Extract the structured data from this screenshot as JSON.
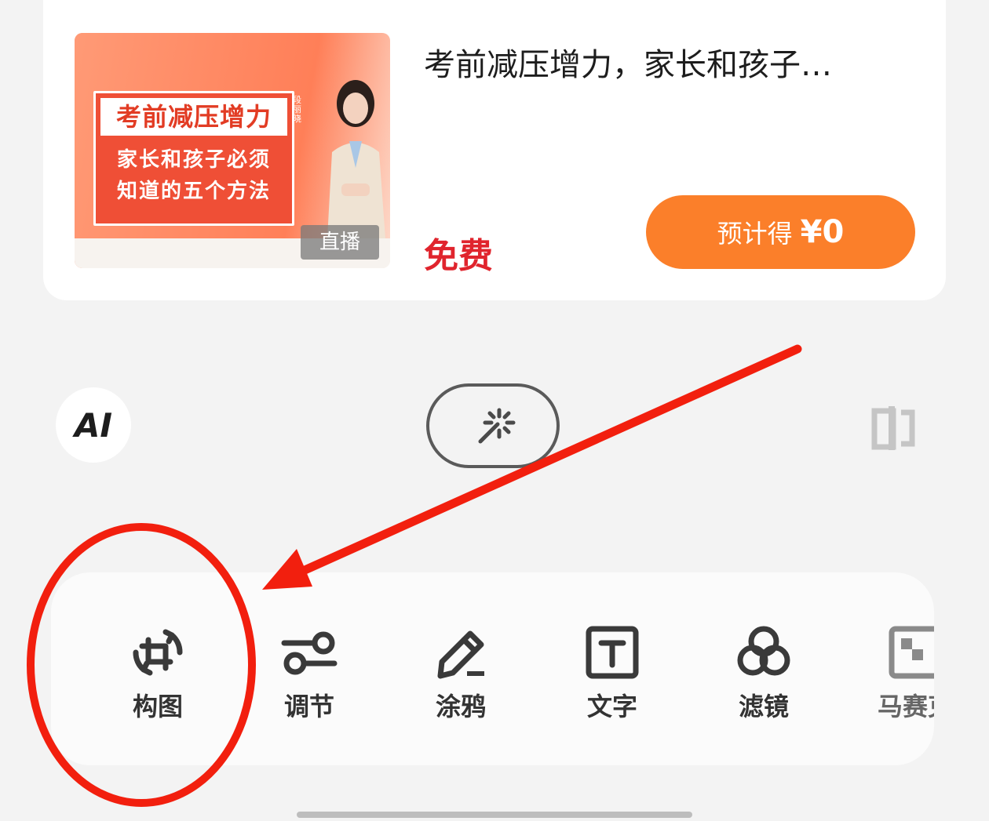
{
  "card": {
    "thumbnail": {
      "headline": "考前减压增力",
      "line1": "家长和孩子必须",
      "line2": "知道的五个方法",
      "live_tag": "直播",
      "person_name": "段丽晓"
    },
    "title": "考前减压增力，家长和孩子…",
    "price": "免费",
    "earn_button": {
      "label": "预计得",
      "amount": "¥0"
    }
  },
  "middle_bar": {
    "ai_label": "AI",
    "magic_icon": "magic-wand-icon",
    "compare_icon": "compare-icon"
  },
  "tools": [
    {
      "label": "构图",
      "icon": "crop-rotate-icon"
    },
    {
      "label": "调节",
      "icon": "sliders-icon"
    },
    {
      "label": "涂鸦",
      "icon": "pencil-icon"
    },
    {
      "label": "文字",
      "icon": "text-box-icon"
    },
    {
      "label": "滤镜",
      "icon": "filter-circles-icon"
    },
    {
      "label": "马赛克",
      "icon": "mosaic-icon"
    }
  ],
  "annotation": {
    "color": "#f21f0e"
  },
  "colors": {
    "accent": "#fb7f2a",
    "price": "#e0242d"
  }
}
